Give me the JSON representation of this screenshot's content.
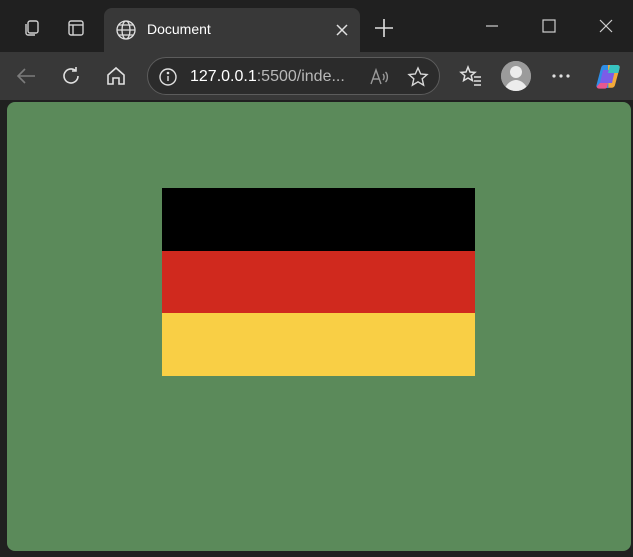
{
  "tab": {
    "title": "Document"
  },
  "address": {
    "host": "127.0.0.1",
    "path": ":5500/inde..."
  },
  "page": {
    "background": "#5b8a5a",
    "flag": {
      "stripes": [
        "#000000",
        "#d0291e",
        "#f9cf45"
      ]
    }
  },
  "icons": {
    "workspaces": "workspaces-icon",
    "tab_actions": "tab-actions-icon",
    "globe": "globe-icon",
    "close_tab": "close-icon",
    "new_tab": "plus-icon",
    "minimize": "minimize-icon",
    "maximize": "maximize-icon",
    "close_window": "close-window-icon",
    "back": "back-arrow-icon",
    "refresh": "refresh-icon",
    "home": "home-icon",
    "info": "info-icon",
    "read_aloud": "read-aloud-icon",
    "favorite": "star-icon",
    "favorites": "favorites-icon",
    "profile": "profile-icon",
    "more": "more-icon",
    "copilot": "copilot-icon"
  }
}
